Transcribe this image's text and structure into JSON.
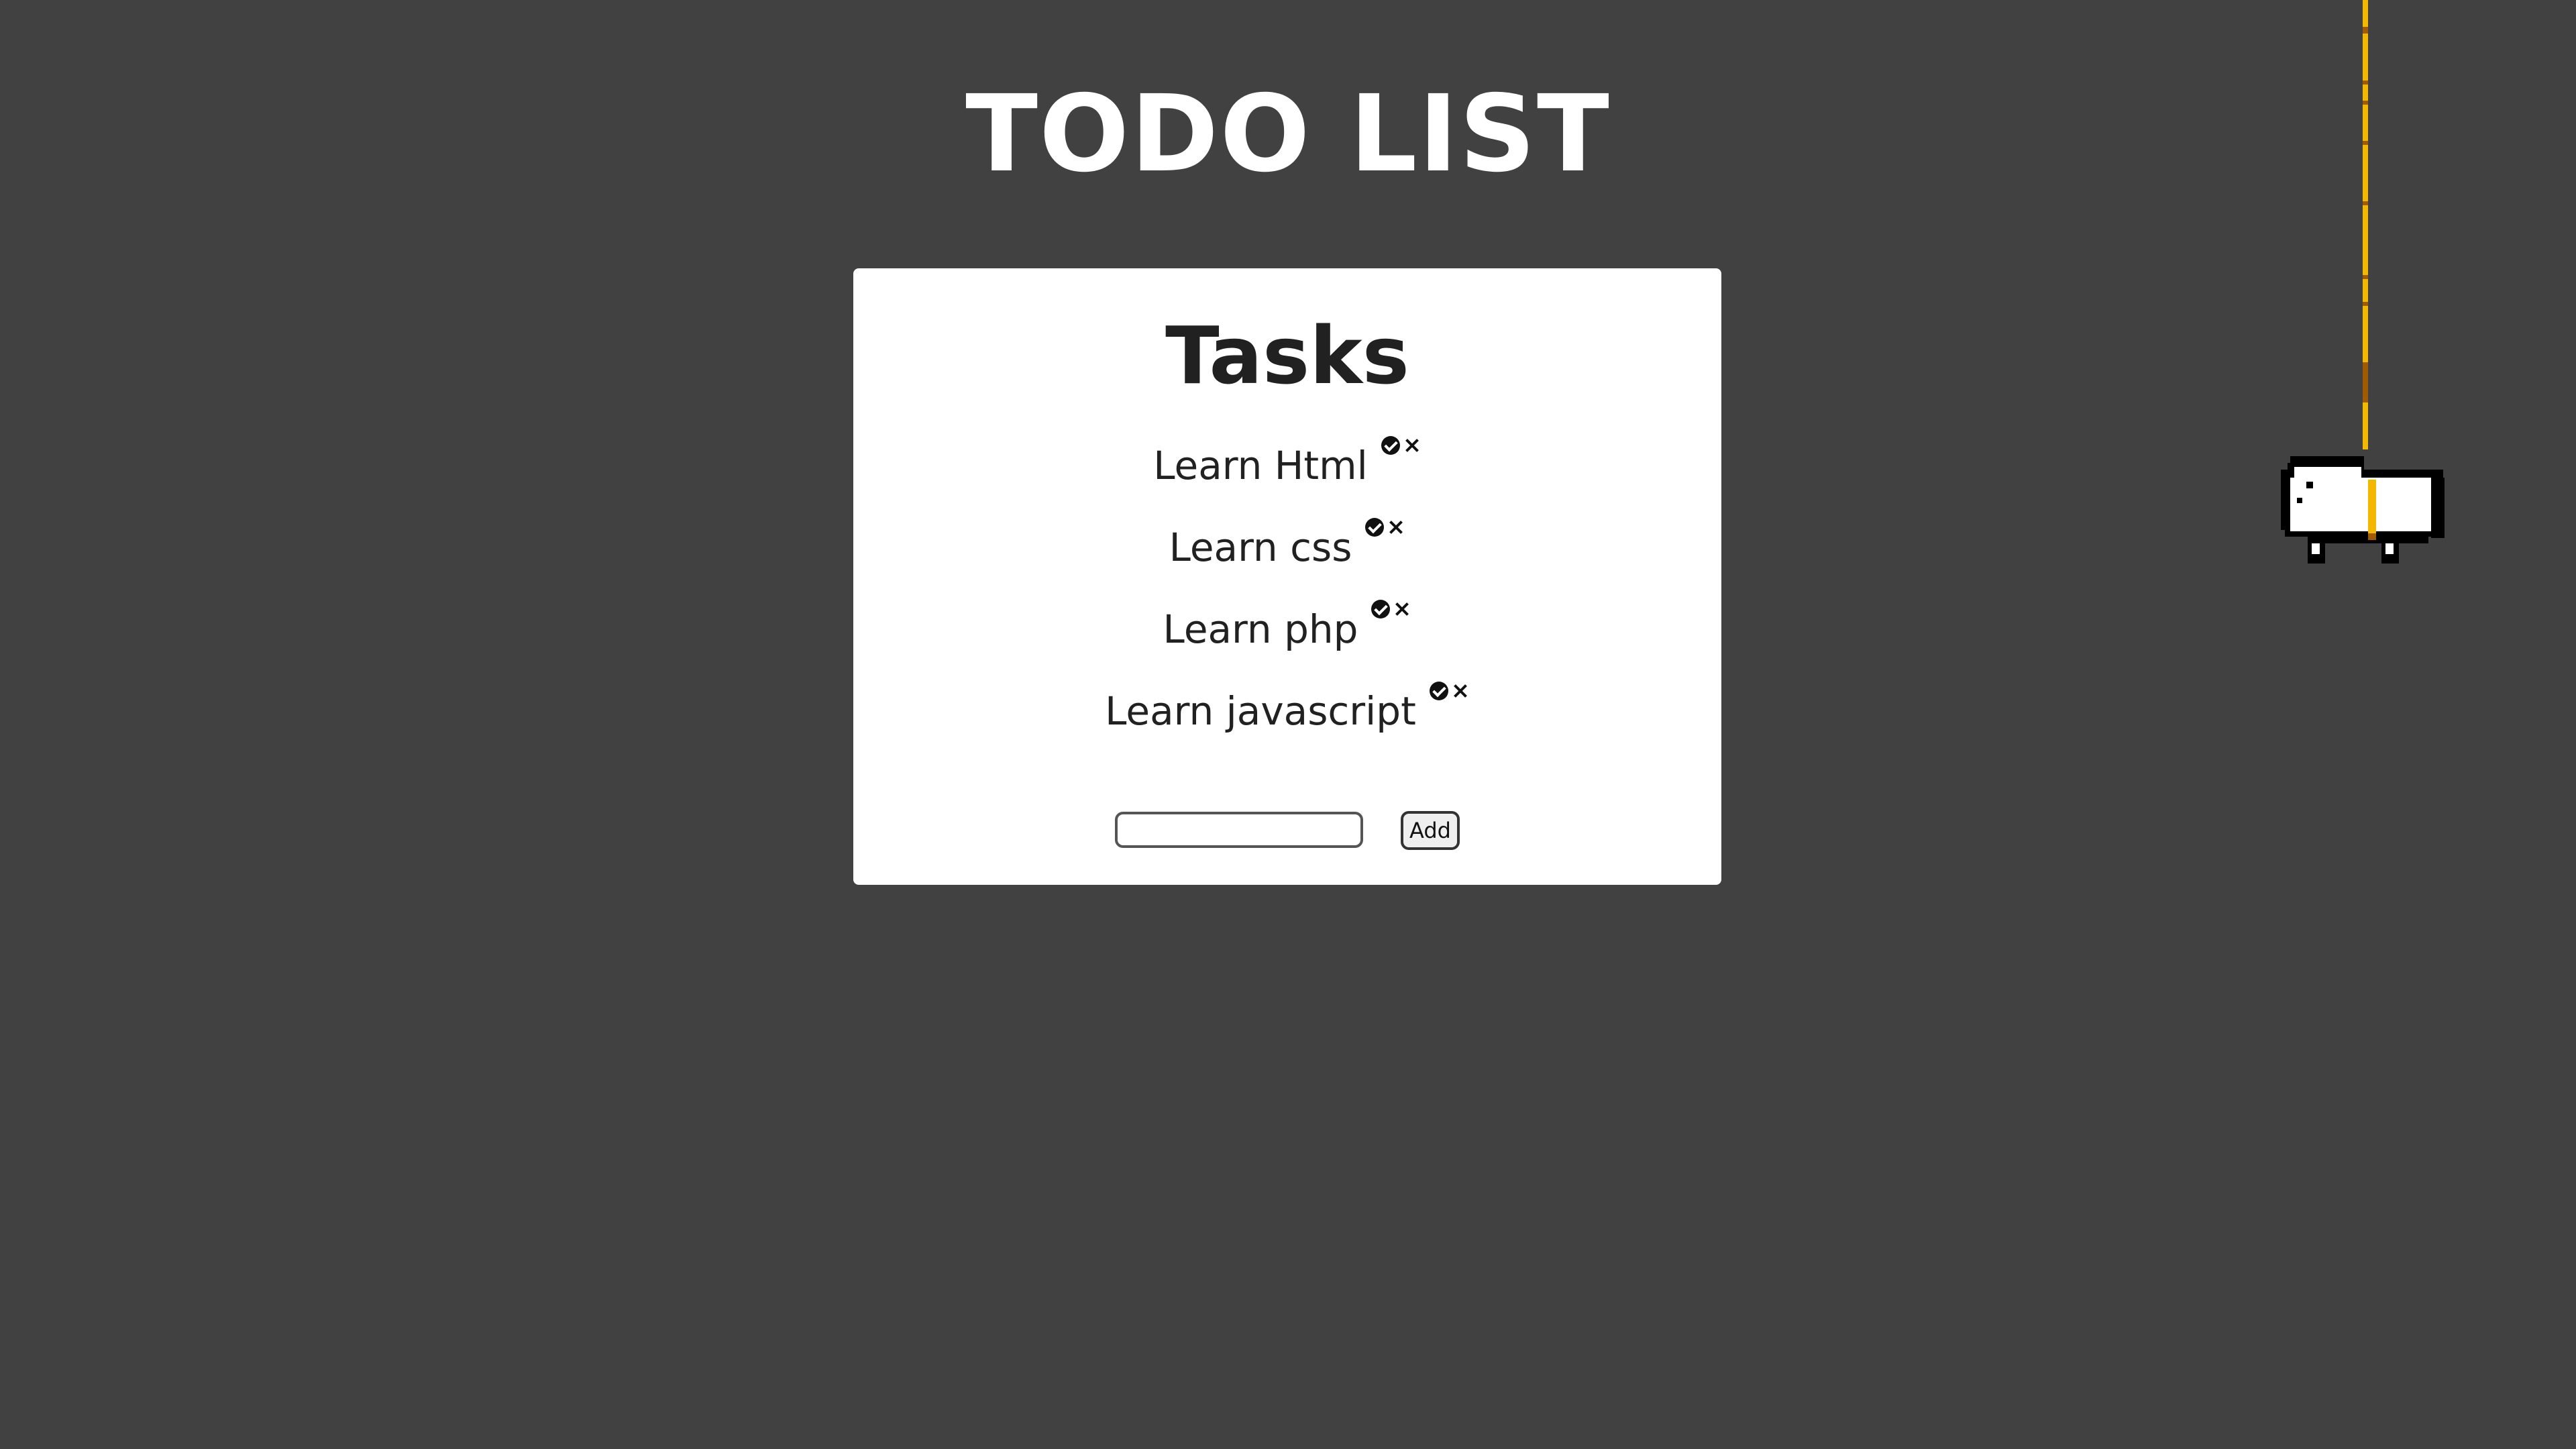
{
  "page": {
    "title": "TODO LIST"
  },
  "card": {
    "title": "Tasks"
  },
  "tasks": [
    {
      "label": "Learn Html"
    },
    {
      "label": "Learn css"
    },
    {
      "label": "Learn php"
    },
    {
      "label": "Learn javascript"
    }
  ],
  "form": {
    "input_value": "",
    "add_label": "Add"
  },
  "icons": {
    "complete": "check-circle-icon",
    "delete": "close-icon",
    "pet": "pixel-dog-icon"
  },
  "colors": {
    "background": "#414141",
    "card": "#ffffff",
    "text_dark": "#212121",
    "leash": "#f5b800"
  }
}
